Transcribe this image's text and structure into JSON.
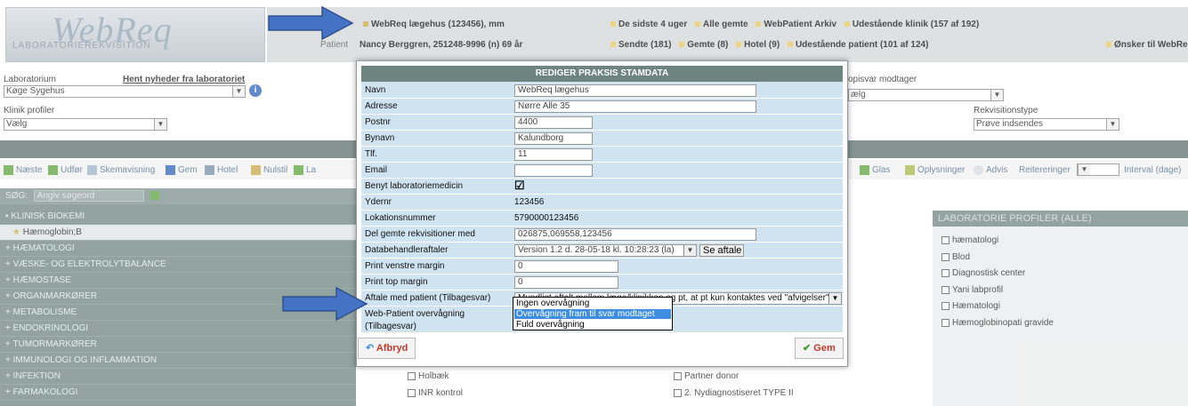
{
  "header": {
    "logo": "WebReq",
    "logo_sub": "LABORATORIEREKVISITION",
    "row1_left": "WebReq lægehus (123456), mm",
    "row1_right": "De sidste 4 uger",
    "row1_all_saved": "Alle gemte",
    "row1_archive": "WebPatient Arkiv",
    "row1_outstanding": "Udestående klinik (157 af 192)",
    "patient_label": "Patient",
    "patient_value": "Nancy Berggren, 251248-9996 (n)  69 år",
    "row2_sent": "Sendte (181)",
    "row2_saved": "Gemte (8)",
    "row2_hotel": "Hotel (9)",
    "row2_outstanding": "Udestående patient (101 af 124)",
    "row2_far": "Ønsker til WebRe"
  },
  "filters": {
    "lab_label": "Laboratorium",
    "lab_news": "Hent nyheder fra laboratoriet",
    "lab_value": "Køge Sygehus",
    "profiles_label": "Klinik profiler",
    "profiles_value": "Vælg",
    "copy_label": "opisvar modtager",
    "copy_value": "ælg",
    "req_type_label": "Rekvisitionstype",
    "req_type_value": "Prøve indsendes"
  },
  "toolbar": {
    "next": "Næste",
    "execute": "Udfør",
    "form_view": "Skemavisning",
    "save": "Gem",
    "hotel": "Hotel",
    "reset": "Nulstil",
    "la": "La",
    "glass": "Glas",
    "info": "Oplysninger",
    "warning": "Advis",
    "reiterations": "Reitereringer",
    "interval": "Interval (dage)"
  },
  "left_list": {
    "search_label": "SØG:",
    "search_placeholder": "Angiv søgeord",
    "items": [
      "KLINISK BIOKEMI",
      "Hæmoglobin;B",
      "HÆMATOLOGI",
      "VÆSKE- OG ELEKTROLYTBALANCE",
      "HÆMOSTASE",
      "ORGANMARKØRER",
      "METABOLISME",
      "ENDOKRINOLOGI",
      "TUMORMARKØRER",
      "IMMUNOLOGI OG INFLAMMATION",
      "INFEKTION",
      "FARMAKOLOGI"
    ]
  },
  "right_panel": {
    "title": "LABORATORIE PROFILER (ALLE)",
    "items": [
      "hæmatologi",
      "Blod",
      "Diagnostisk center",
      "Yani labprofil",
      "Hæmatologi",
      "Hæmoglobinopati gravide"
    ]
  },
  "bottom_items": {
    "holbaek": "Holbæk",
    "inr": "INR kontrol",
    "partner": "Partner donor",
    "nydiagnostiseret": "2. Nydiagnostiseret TYPE II"
  },
  "modal": {
    "title": "REDIGER PRAKSIS STAMDATA",
    "fields": {
      "navn_label": "Navn",
      "navn_value": "WebReq lægehus",
      "adresse_label": "Adresse",
      "adresse_value": "Nørre Alle 35",
      "postnr_label": "Postnr",
      "postnr_value": "4400",
      "bynavn_label": "Bynavn",
      "bynavn_value": "Kalundborg",
      "tlf_label": "Tlf.",
      "tlf_value": "11",
      "email_label": "Email",
      "email_value": "",
      "benyt_label": "Benyt laboratoriemedicin",
      "ydernr_label": "Ydernr",
      "ydernr_value": "123456",
      "lokation_label": "Lokationsnummer",
      "lokation_value": "5790000123456",
      "del_label": "Del gemte rekvisitioner med",
      "del_value": "026875,069558,123456",
      "databeh_label": "Databehandleraftaler",
      "databeh_value": "Version 1.2 d. 28-05-18 kl. 10:28:23 (la)",
      "se_aftale": "Se aftale",
      "print_v_label": "Print venstre margin",
      "print_v_value": "0",
      "print_t_label": "Print top margin",
      "print_t_value": "0",
      "aftale_label": "Aftale med patient (Tilbagesvar)",
      "aftale_value": "Mundligt aftalt mellem læge/klinikken og pt, at pt kun kontaktes ved \"afvigelser\"",
      "webpat_label": "Web-Patient overvågning",
      "webpat_label2": "(Tilbagesvar)"
    },
    "dropdown_options": [
      "Ingen overvågning",
      "Overvågning fram til svar modtaget",
      "Fuld overvågning"
    ],
    "cancel": "Afbryd",
    "save": "Gem"
  },
  "colors": {
    "accent_blue": "#4472c4",
    "selected": "#3d8ee0",
    "panel": "#6e8481"
  }
}
